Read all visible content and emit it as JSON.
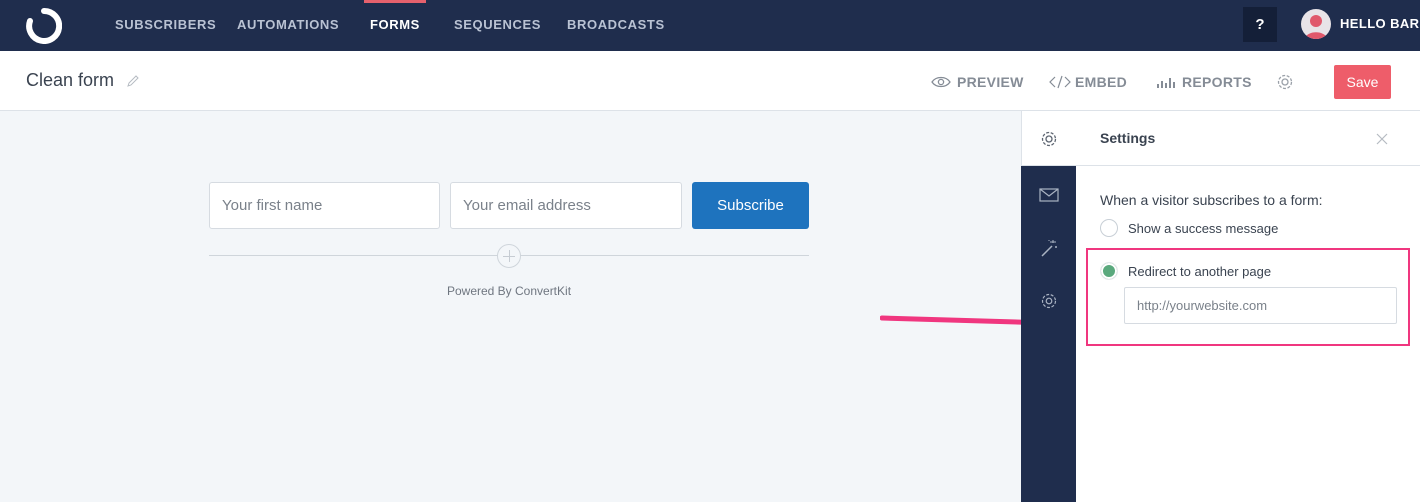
{
  "nav": {
    "items": [
      {
        "label": "SUBSCRIBERS"
      },
      {
        "label": "AUTOMATIONS"
      },
      {
        "label": "FORMS"
      },
      {
        "label": "SEQUENCES"
      },
      {
        "label": "BROADCASTS"
      }
    ],
    "active": "FORMS",
    "help_label": "?",
    "account_name": "HELLO BAR"
  },
  "header": {
    "title": "Clean form",
    "actions": [
      {
        "label": "PREVIEW",
        "icon": "eye-icon"
      },
      {
        "label": "EMBED",
        "icon": "code-icon"
      },
      {
        "label": "REPORTS",
        "icon": "bar-chart-icon"
      }
    ],
    "save_label": "Save"
  },
  "form_preview": {
    "first_name_placeholder": "Your first name",
    "email_placeholder": "Your email address",
    "subscribe_label": "Subscribe",
    "powered_by": "Powered By ConvertKit"
  },
  "settings": {
    "title": "Settings",
    "question": "When a visitor subscribes to a form:",
    "options": [
      {
        "label": "Show a success message",
        "selected": false
      },
      {
        "label": "Redirect to another page",
        "selected": true
      }
    ],
    "redirect_placeholder": "http://yourwebsite.com"
  },
  "colors": {
    "nav_bg": "#1f2d4d",
    "accent": "#ee5d6a",
    "primary": "#1e73be",
    "highlight": "#f0367f",
    "radio_selected": "#5aa97d"
  }
}
